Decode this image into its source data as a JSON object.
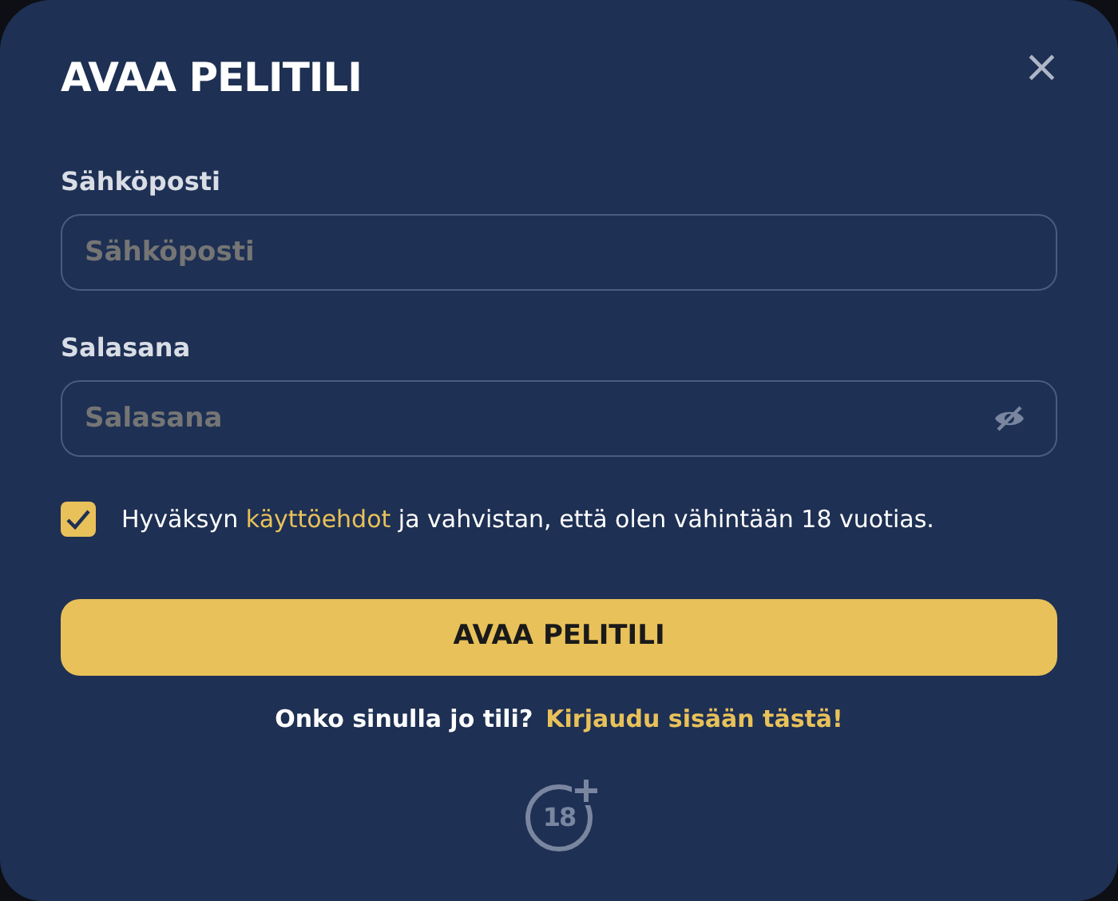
{
  "title": "AVAA PELITILI",
  "close": "×",
  "fields": [
    {
      "label": "Sähköposti",
      "placeholder": "Sähköposti",
      "kind": "email"
    },
    {
      "label": "Salasana",
      "placeholder": "Salasana",
      "kind": "password"
    }
  ],
  "terms": {
    "checked": true,
    "before": "Hyväksyn",
    "link": "käyttöehdot",
    "after": "ja vahvistan, että olen vähintään 18 vuotias."
  },
  "submit": "AVAA PELITILI",
  "login": {
    "question": "Onko sinulla jo tili?",
    "link": "Kirjaudu sisään tästä!"
  },
  "age_badge": "18"
}
